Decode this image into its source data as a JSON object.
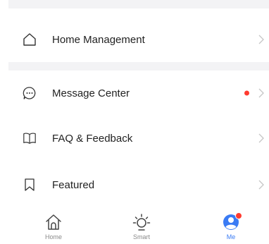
{
  "menu": {
    "home_management": "Home Management",
    "message_center": "Message Center",
    "faq_feedback": "FAQ & Feedback",
    "featured": "Featured"
  },
  "tabs": {
    "home": "Home",
    "smart": "Smart",
    "me": "Me",
    "active": "me"
  },
  "icons": {
    "home_management": "house-outline-icon",
    "message_center": "chat-bubble-icon",
    "faq_feedback": "open-book-icon",
    "featured": "bookmark-icon",
    "chevron": "chevron-right-icon",
    "tab_home": "house-icon",
    "tab_smart": "sun-icon",
    "tab_me": "person-avatar-icon"
  },
  "colors": {
    "accent": "#3a7bf4",
    "notification": "#ff3b30",
    "divider": "#f3f3f5"
  },
  "message_center": {
    "has_unread": true
  },
  "me_tab": {
    "has_badge": true
  }
}
